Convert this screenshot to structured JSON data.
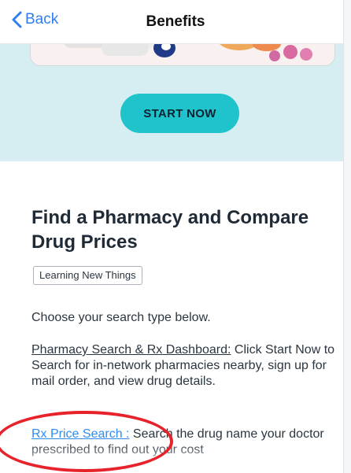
{
  "nav": {
    "back_label": "Back",
    "title": "Benefits"
  },
  "hero": {
    "cta_label": "START NOW"
  },
  "main": {
    "title": "Find a Pharmacy and Compare Drug Prices",
    "tag": "Learning New Things",
    "intro": "Choose your search type below.",
    "pharmacy_link": "Pharmacy Search & Rx Dashboard:",
    "pharmacy_text": " Click Start Now to Search for in-network pharmacies nearby, sign up for mail order, and view drug details.",
    "rx_link": "Rx Price Search :",
    "rx_text": " Search the drug name your doctor prescribed to find out your cost"
  },
  "colors": {
    "accent": "#1fc3cc",
    "link": "#2f8cef",
    "hero_bg": "#d6eef1",
    "annotation": "#e8222a"
  },
  "icons": {
    "back": "chevron-left-icon"
  }
}
